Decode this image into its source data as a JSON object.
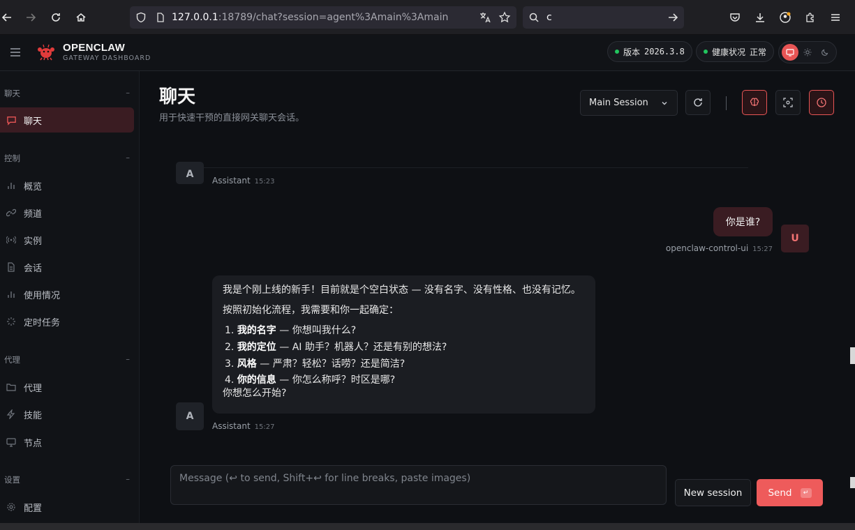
{
  "browser": {
    "url_host": "127.0.0.1",
    "url_rest": ":18789/chat?session=agent%3Amain%3Amain",
    "search_value": "c"
  },
  "header": {
    "brand_title": "OPENCLAW",
    "brand_subtitle": "GATEWAY DASHBOARD",
    "version_label": "版本",
    "version_value": "2026.3.8",
    "health_label": "健康状况",
    "health_value": "正常",
    "accent": "#e85555",
    "status_color": "#22c55e"
  },
  "sidebar": {
    "sections": [
      {
        "title": "聊天",
        "collapse": "–",
        "items": [
          {
            "label": "聊天",
            "icon": "message-icon",
            "active": true
          }
        ]
      },
      {
        "title": "控制",
        "collapse": "–",
        "items": [
          {
            "label": "概览",
            "icon": "bar-chart-icon"
          },
          {
            "label": "频道",
            "icon": "link-icon"
          },
          {
            "label": "实例",
            "icon": "radio-icon"
          },
          {
            "label": "会话",
            "icon": "document-icon"
          },
          {
            "label": "使用情况",
            "icon": "bar-chart-icon"
          },
          {
            "label": "定时任务",
            "icon": "loader-icon"
          }
        ]
      },
      {
        "title": "代理",
        "collapse": "–",
        "items": [
          {
            "label": "代理",
            "icon": "folder-icon"
          },
          {
            "label": "技能",
            "icon": "zap-icon"
          },
          {
            "label": "节点",
            "icon": "monitor-icon"
          }
        ]
      },
      {
        "title": "设置",
        "collapse": "–",
        "items": [
          {
            "label": "配置",
            "icon": "gear-icon"
          }
        ]
      }
    ]
  },
  "main": {
    "title": "聊天",
    "subtitle": "用于快速干预的直接网关聊天会话。",
    "session_select": "Main Session"
  },
  "chat": {
    "messages": [
      {
        "role": "assistant",
        "avatar": "A",
        "author": "Assistant",
        "time": "15:23"
      },
      {
        "role": "user",
        "avatar": "U",
        "author": "openclaw-control-ui",
        "time": "15:27",
        "text": "你是谁?"
      },
      {
        "role": "assistant",
        "avatar": "A",
        "author": "Assistant",
        "time": "15:27",
        "p1": "我是个刚上线的新手！目前就是个空白状态 — 没有名字、没有性格、也没有记忆。",
        "p2": "按照初始化流程，我需要和你一起确定：",
        "list": [
          {
            "num": "1.",
            "bold": "我的名字",
            "rest": " — 你想叫我什么?"
          },
          {
            "num": "2.",
            "bold": "我的定位",
            "rest": " — AI 助手？机器人？还是有别的想法?"
          },
          {
            "num": "3.",
            "bold": "风格",
            "rest": " — 严肃？轻松？话唠？还是简洁?"
          },
          {
            "num": "4.",
            "bold": "你的信息",
            "rest": " — 你怎么称呼？时区是哪?"
          }
        ],
        "closing": "你想怎么开始?"
      }
    ]
  },
  "composer": {
    "placeholder": "Message (↩ to send, Shift+↩ for line breaks, paste images)",
    "value": "",
    "new_session_label": "New session",
    "send_label": "Send",
    "send_kbd": "↵"
  }
}
